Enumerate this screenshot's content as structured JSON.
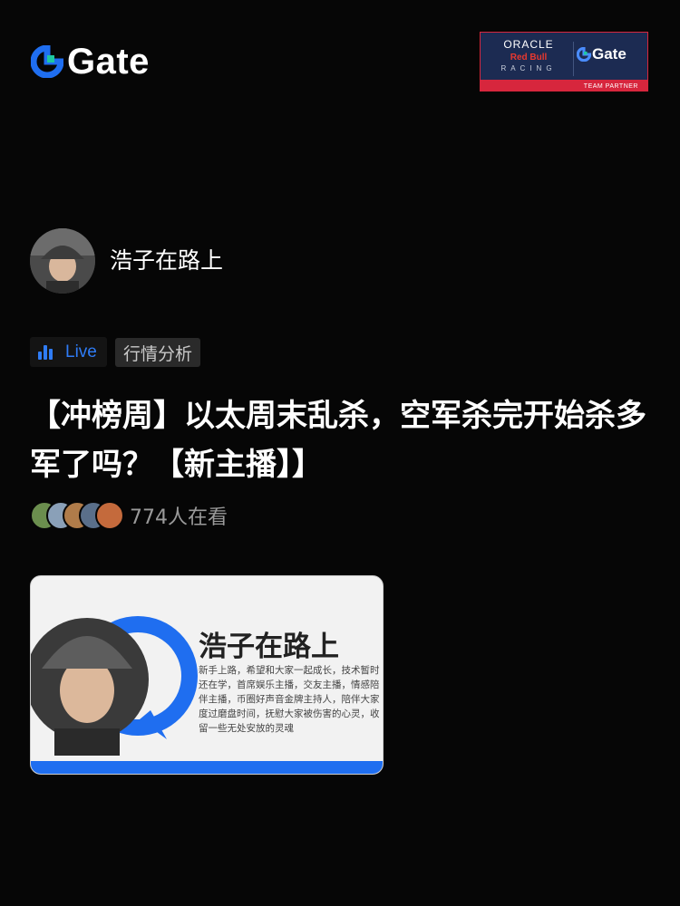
{
  "brand": {
    "name": "Gate",
    "accent": "#2f7cf6",
    "mark_color": "#1f6ef0",
    "mark_accent": "#1ec8a0"
  },
  "partner_badge": {
    "oracle": "ORACLE",
    "red_bull": "Red Bull",
    "racing": "RACING",
    "gate": "Gate",
    "caption": "TEAM PARTNER"
  },
  "streamer": {
    "name": "浩子在路上",
    "avatar_icon": "user-photo-icon"
  },
  "tags": {
    "live": "Live",
    "topic": "行情分析"
  },
  "stream": {
    "title": "【冲榜周】以太周末乱杀，空军杀完开始杀多军了吗？【新主播】】",
    "viewer_count": "774人在看"
  },
  "viewer_avatar_colors": [
    "#6b8e4e",
    "#8aa0b8",
    "#b07c4a",
    "#5a6f8a",
    "#c46a3c"
  ],
  "cover": {
    "name": "浩子在路上",
    "description": "新手上路，希望和大家一起成长，技术暂时还在学，首席娱乐主播，交友主播，情感陪伴主播，币圈好声音金牌主持人，陪伴大家度过磨盘时间，抚慰大家被伤害的心灵，收留一些无处安放的灵魂"
  }
}
